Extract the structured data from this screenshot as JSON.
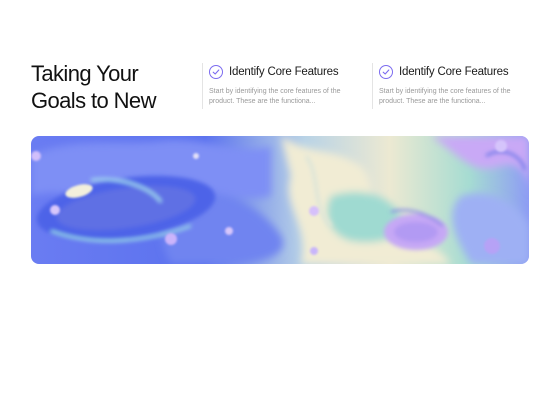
{
  "hero": {
    "title_line1": "Taking Your",
    "title_line2": "Goals to New"
  },
  "features": [
    {
      "icon": "check-circle-icon",
      "title": "Identify Core Features",
      "description_line1": "Start by identifying the core features of the",
      "description_line2": "product. These are the functiona..."
    },
    {
      "icon": "check-circle-icon",
      "title": "Identify Core Features",
      "description_line1": "Start by identifying the core features of the",
      "description_line2": "product. These are the functiona..."
    }
  ],
  "banner": {
    "image": "fluid-marble-art",
    "colors": {
      "blue": "#5a6ff0",
      "cream": "#e8e6cf",
      "teal": "#8fd4cc",
      "lilac": "#c6a8f5"
    }
  },
  "theme": {
    "accent": "#7c6cf0",
    "text": "#111111",
    "muted": "#9a9a9a",
    "divider": "#e4e4e4"
  }
}
